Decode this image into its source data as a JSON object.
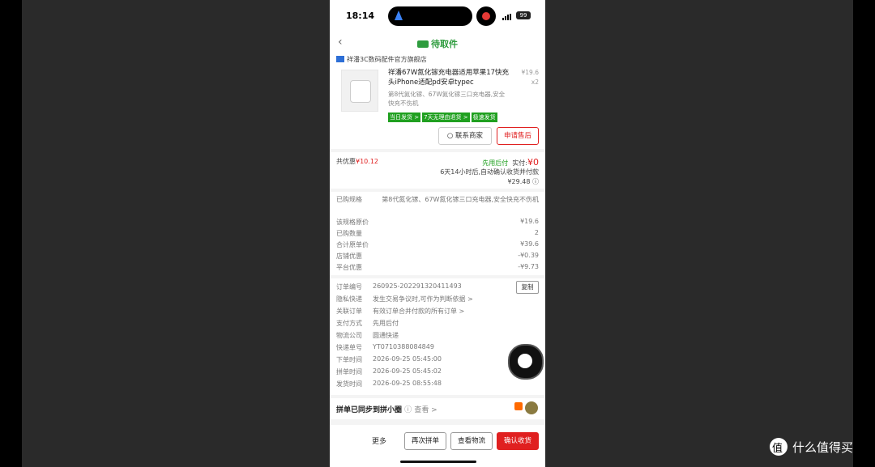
{
  "status_bar": {
    "time": "18:14",
    "battery": "99"
  },
  "nav": {
    "title": "待取件"
  },
  "goods": {
    "shop": "祥潘3C数码配件官方旗舰店",
    "title": "祥潘67W氮化镓充电器适用苹果17快充头iPhone适配pd安卓typec",
    "spec": "第8代氮化镓、67W氮化镓三口充电器,安全快充不伤机",
    "unit_price": "¥19.6",
    "qty": "x2",
    "tags": [
      "当日发货 >",
      "7天无理由退货 >",
      "极速发货"
    ],
    "contact_button": "联系商家",
    "aftersale_button": "申请售后"
  },
  "summary": {
    "discount_label": "共优惠",
    "discount_value": "¥10.12",
    "pay_later": "先用后付",
    "paid_label": "实付:",
    "paid_value": "¥0",
    "auto_note": "6天14小时后,自动确认收货并付款",
    "auto_amount": "¥29.48"
  },
  "details": {
    "spec_label": "已购规格",
    "spec_value": "第8代氮化镓、67W氮化镓三口充电器,安全快充不伤机",
    "rows": [
      {
        "label": "该规格原价",
        "value": "¥19.6"
      },
      {
        "label": "已购数量",
        "value": "2"
      },
      {
        "label": "合计原单价",
        "value": "¥39.6"
      },
      {
        "label": "店铺优惠",
        "value": "-¥0.39"
      },
      {
        "label": "平台优惠",
        "value": "-¥9.73"
      }
    ]
  },
  "order_info": [
    {
      "label": "订单编号",
      "value": "260925-2022913204114​93"
    },
    {
      "label": "隐私快递",
      "value": "发生交易争议时,可作为判断依据 >"
    },
    {
      "label": "关联订单",
      "value": "有效订单合并付款的所有订单 >"
    },
    {
      "label": "支付方式",
      "value": "先用后付"
    },
    {
      "label": "物流公司",
      "value": "圆通快递"
    },
    {
      "label": "快递单号",
      "value": "YT0710388084849"
    },
    {
      "label": "下单时间",
      "value": "2026-09-25 05:45:00"
    },
    {
      "label": "拼单时间",
      "value": "2026-09-25 05:45:02"
    },
    {
      "label": "发货时间",
      "value": "2026-09-25 08:55:48"
    }
  ],
  "copy_button": "复制",
  "sync_bar": {
    "text": "拼单已同步到拼小圈",
    "link": "查看 >"
  },
  "bottom_bar": {
    "more": "更多",
    "reorder": "再次拼单",
    "logistics": "查看物流",
    "confirm": "确认收货"
  },
  "watermark": "什么值得买"
}
